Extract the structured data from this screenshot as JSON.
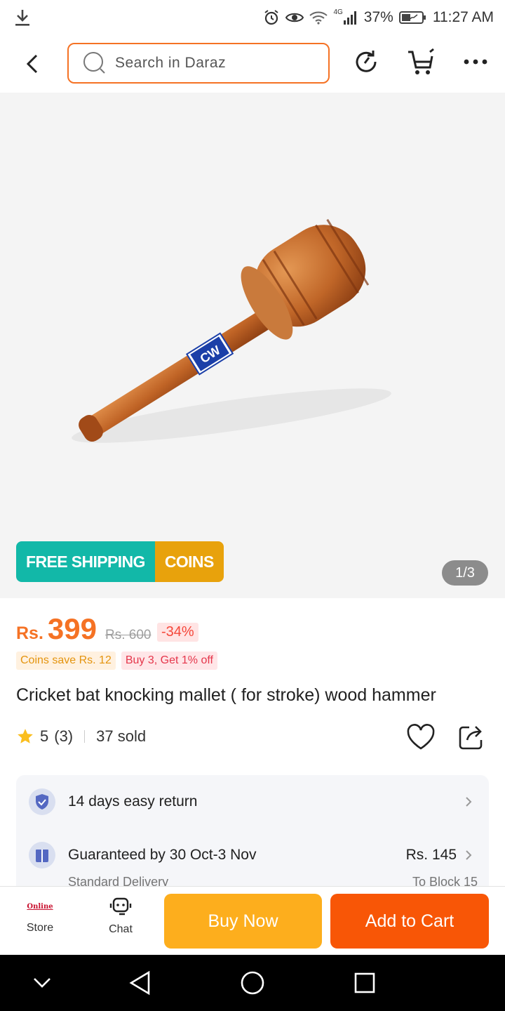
{
  "status_bar": {
    "network": "4G",
    "battery": "37%",
    "time": "11:27 AM"
  },
  "top_nav": {
    "search_placeholder": "Search in Daraz"
  },
  "product_image": {
    "pager": "1/3",
    "promo_free_shipping": "FREE SHIPPING",
    "promo_coins": "COINS",
    "brand_label": "CW"
  },
  "price": {
    "currency": "Rs.",
    "current": "399",
    "original": "Rs. 600",
    "discount": "-34%"
  },
  "tags": {
    "coins_save": "Coins save Rs. 12",
    "bundle": "Buy 3, Get 1% off"
  },
  "product": {
    "title": "Cricket bat knocking mallet ( for stroke) wood hammer",
    "rating": "5",
    "rating_count": "(3)",
    "sold": "37 sold"
  },
  "info_card": {
    "return_text": "14 days easy return",
    "delivery_text": "Guaranteed by 30 Oct-3 Nov",
    "delivery_sub": "Standard Delivery",
    "delivery_price": "Rs. 145",
    "delivery_location": "To Block 15"
  },
  "bottom_bar": {
    "store_label": "Store",
    "store_logo_text": "Online",
    "chat_label": "Chat",
    "buy_now": "Buy Now",
    "add_to_cart": "Add to Cart"
  },
  "colors": {
    "accent": "#f57224",
    "buy_now": "#fdae1d",
    "add_to_cart": "#f85606",
    "free_shipping": "#12b8a8",
    "coins": "#e8a20c"
  }
}
